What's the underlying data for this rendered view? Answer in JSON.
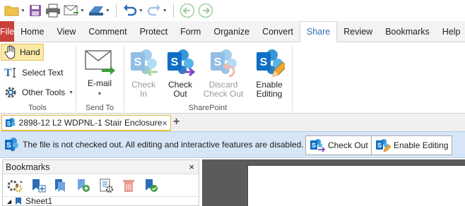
{
  "ribbon_tabs": [
    "File",
    "Home",
    "View",
    "Comment",
    "Protect",
    "Form",
    "Organize",
    "Convert",
    "Share",
    "Review",
    "Bookmarks",
    "Help"
  ],
  "active_tab": "Share",
  "tools_group": {
    "label": "Tools",
    "hand": "Hand",
    "select_text": "Select Text",
    "other_tools": "Other Tools"
  },
  "send_to_group": {
    "label": "Send To",
    "email_line1": "E-mail"
  },
  "sharepoint_group": {
    "label": "SharePoint",
    "check_in": [
      "Check",
      "In"
    ],
    "check_out": [
      "Check",
      "Out"
    ],
    "discard_check_out": [
      "Discard",
      "Check Out"
    ],
    "enable_editing": [
      "Enable",
      "Editing"
    ]
  },
  "document_tab": {
    "title": "2898-12 L2 WDPNL-1 Stair Enclosure",
    "close": "×",
    "add": "+"
  },
  "notification": {
    "message": "The file is not checked out. All editing and interactive features are disabled.",
    "check_out_button": "Check Out",
    "enable_editing_button": "Enable Editing"
  },
  "bookmarks_panel": {
    "title": "Bookmarks",
    "close": "×",
    "items": [
      "Sheet1"
    ]
  },
  "colors": {
    "file_tab": "#c9403a",
    "active_tab_text": "#2e6db4",
    "sharepoint_blue": "#0f6fc6",
    "notification_bg": "#d7e6f7",
    "hand_highlight": "#fbe9a7",
    "doc_area_bg": "#5b5b5b"
  }
}
